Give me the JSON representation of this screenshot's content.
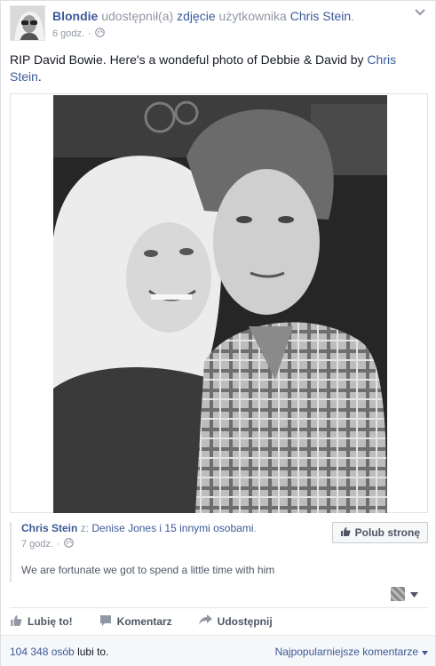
{
  "header": {
    "author": "Blondie",
    "action_text": "udostępnił(a)",
    "object_link": "zdjęcie",
    "of_text": "użytkownika",
    "source_name": "Chris Stein",
    "trailing": ".",
    "time": "6 godz."
  },
  "message": {
    "text": "RIP David Bowie. Here's a wondeful photo of Debbie & David by ",
    "link": "Chris Stein",
    "trailing": "."
  },
  "source": {
    "name": "Chris Stein",
    "with_prefix": "z:",
    "tagged": "Denise Jones i 15 innymi osobami",
    "tagged_trailing": ".",
    "time": "7 godz.",
    "text": "We are fortunate we got to spend a little time with him",
    "like_page_label": "Polub stronę"
  },
  "actions": {
    "like": "Lubię to!",
    "comment": "Komentarz",
    "share": "Udostępnij"
  },
  "footer": {
    "likes_count": "104 348 osób",
    "likes_rest": "lubi to.",
    "sort_label": "Najpopularniejsze komentarze"
  },
  "colors": {
    "link": "#3b5998",
    "muted": "#9197a3",
    "text": "#141823"
  }
}
